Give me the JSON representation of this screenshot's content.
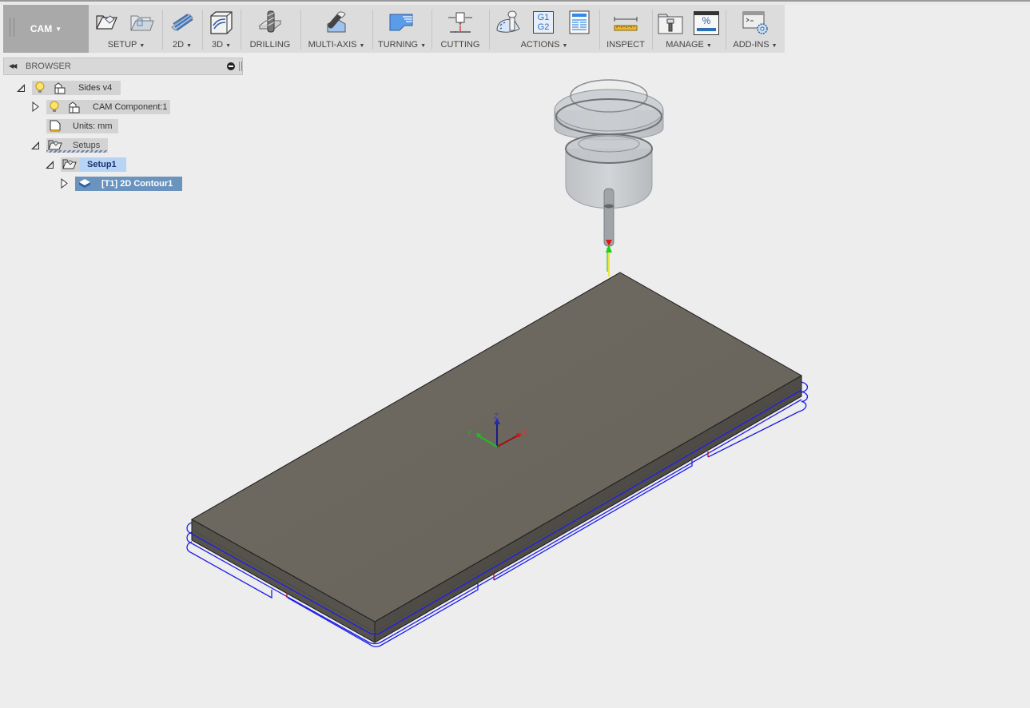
{
  "workspace": {
    "label": "CAM",
    "dropdown": true
  },
  "toolbar": {
    "groups": [
      {
        "label": "SETUP",
        "dropdown": true,
        "icons": [
          "setup-icon",
          "folder-setup-icon"
        ]
      },
      {
        "label": "2D",
        "dropdown": true,
        "icons": [
          "2d-adaptive-icon"
        ]
      },
      {
        "label": "3D",
        "dropdown": true,
        "icons": [
          "3d-adaptive-icon"
        ]
      },
      {
        "label": "DRILLING",
        "dropdown": false,
        "icons": [
          "drill-icon"
        ]
      },
      {
        "label": "MULTI-AXIS",
        "dropdown": true,
        "icons": [
          "multi-axis-icon"
        ]
      },
      {
        "label": "TURNING",
        "dropdown": true,
        "icons": [
          "turning-icon"
        ]
      },
      {
        "label": "CUTTING",
        "dropdown": false,
        "icons": [
          "cutting-icon"
        ]
      },
      {
        "label": "ACTIONS",
        "dropdown": true,
        "icons": [
          "simulate-icon",
          "post-process-icon",
          "setup-sheet-icon"
        ],
        "gcode_text": [
          "G1",
          "G2"
        ]
      },
      {
        "label": "INSPECT",
        "dropdown": false,
        "icons": [
          "measure-icon"
        ]
      },
      {
        "label": "MANAGE",
        "dropdown": true,
        "icons": [
          "tool-library-icon",
          "task-manager-icon"
        ],
        "percent_text": "%"
      },
      {
        "label": "ADD-INS",
        "dropdown": true,
        "icons": [
          "scripts-addins-icon"
        ]
      }
    ]
  },
  "browser": {
    "title": "BROWSER",
    "tree": [
      {
        "label": "Sides v4",
        "expanded": true,
        "visible": true,
        "icon": "component-icon"
      },
      {
        "label": "CAM Component:1",
        "expanded": false,
        "visible": true,
        "icon": "component-icon"
      },
      {
        "label": "Units: mm",
        "icon": "units-document-icon"
      },
      {
        "label": "Setups",
        "expanded": true,
        "icon": "setups-folder-icon"
      },
      {
        "label": "Setup1",
        "expanded": true,
        "icon": "setup-folder-icon",
        "active": true
      },
      {
        "label": "[T1] 2D Contour1",
        "expanded": false,
        "icon": "operation-icon",
        "selected": true
      }
    ]
  },
  "viewport": {
    "triad": {
      "x": "X",
      "y": "Y",
      "z": "Z"
    },
    "colors": {
      "stock": "#6b6760",
      "stock_side": "#56534d",
      "toolpath": "#1e1eea",
      "lead": "#cc1010",
      "background": "#ededed",
      "selection": "#6a94bd",
      "active_setup": "#b8d4f5"
    }
  }
}
